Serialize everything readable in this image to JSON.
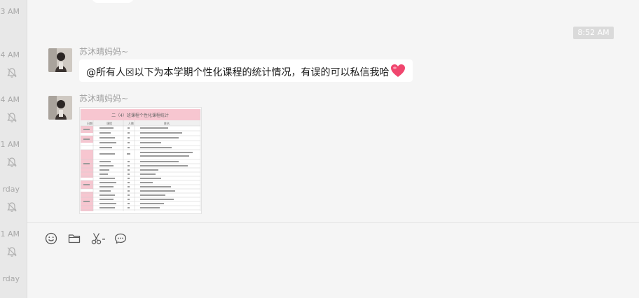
{
  "sidebar_strip": {
    "items": [
      {
        "time": "3 AM",
        "muted": false
      },
      {
        "time": "4 AM",
        "muted": true
      },
      {
        "time": "4 AM",
        "muted": true
      },
      {
        "time": "1 AM",
        "muted": true
      },
      {
        "time": "rday",
        "muted": true
      },
      {
        "time": "1 AM",
        "muted": true
      },
      {
        "time": "rday",
        "muted": true
      }
    ]
  },
  "chat": {
    "timestamp": "8:52 AM",
    "messages": [
      {
        "sender": "苏沐晴妈妈~",
        "type": "text",
        "text": "@所有人☒以下为本学期个性化课程的统计情况，有误的可以私信我哈"
      },
      {
        "sender": "苏沐晴妈妈~",
        "type": "image",
        "image": {
          "title": "二（4）班课程个性化课程统计",
          "columns": [
            "日期",
            "课程",
            "人数",
            "姓名"
          ]
        }
      }
    ]
  },
  "toolbar": {
    "icons": [
      "emoji-icon",
      "folder-icon",
      "scissors-icon",
      "chat-bubble-icon"
    ]
  },
  "colors": {
    "background": "#f5f5f5",
    "bubble": "#ffffff",
    "heart": "#f0466e",
    "table_header": "#f7c6d0"
  }
}
